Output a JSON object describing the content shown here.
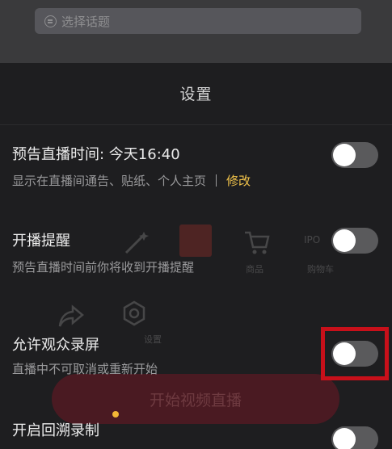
{
  "topic": {
    "placeholder": "选择话题"
  },
  "sheet": {
    "title": "设置"
  },
  "settings": [
    {
      "title": "预告直播时间: 今天16:40",
      "desc": "显示在直播间通告、贴纸、个人主页",
      "link": "修改",
      "on": false
    },
    {
      "title": "开播提醒",
      "desc": "预告直播时间前你将收到开播提醒",
      "on": false
    },
    {
      "title": "允许观众录屏",
      "desc": "直播中不可取消或重新开始",
      "on": false
    },
    {
      "title": "开启回溯录制",
      "on": false
    }
  ],
  "background": {
    "go_live_label": "开始视频直播",
    "labels": [
      "商品",
      "购物车",
      "IPO",
      "设置"
    ]
  },
  "colors": {
    "accent_link": "#f0c24a",
    "highlight": "#c8101a",
    "toggle_off": "#5a5a5c"
  }
}
